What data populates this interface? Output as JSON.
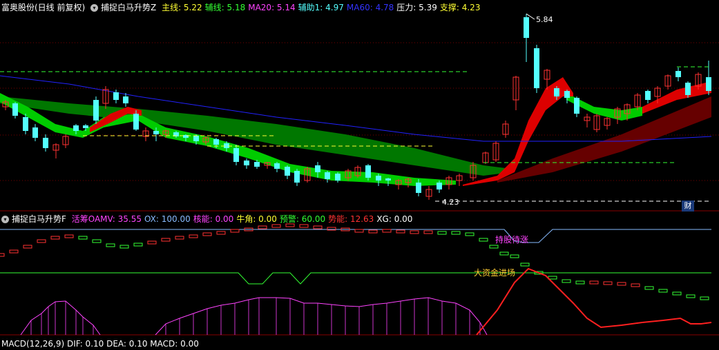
{
  "top_header": {
    "stock": "富奥股份(日线 前复权)",
    "indicator": "捕捉白马升势Z",
    "items": [
      {
        "label": "主线:",
        "value": "5.22",
        "color": "#ffff33"
      },
      {
        "label": "辅线:",
        "value": "5.18",
        "color": "#33ff33"
      },
      {
        "label": "MA20:",
        "value": "5.14",
        "color": "#ff44ff"
      },
      {
        "label": "辅助1:",
        "value": "4.97",
        "color": "#55ffff"
      },
      {
        "label": "MA60:",
        "value": "4.78",
        "color": "#3333ff"
      },
      {
        "label": "压力:",
        "value": "5.39",
        "color": "#ffffff"
      },
      {
        "label": "支撑:",
        "value": "4.23",
        "color": "#ffff33"
      }
    ]
  },
  "price_chart": {
    "high_label": "5.84",
    "low_label": "4.23",
    "finance_badge": "财",
    "colors": {
      "up": "#ff3232",
      "down": "#54ffff",
      "green_band": "#00cc00",
      "dark_green_band": "#007700",
      "red_band": "#dd0000",
      "dark_red_band": "#660000",
      "ma60": "#2222ff"
    }
  },
  "sub_header": {
    "indicator": "捕捉白马升势F",
    "items": [
      {
        "label": "活筹OAMV:",
        "value": "35.55",
        "color": "#ff44ff"
      },
      {
        "label": "OX:",
        "value": "100.00",
        "color": "#88bbff"
      },
      {
        "label": "核能:",
        "value": "0.00",
        "color": "#ff44ff"
      },
      {
        "label": "牛角:",
        "value": "0.00",
        "color": "#ffff33"
      },
      {
        "label": "预警:",
        "value": "60.00",
        "color": "#33ff33"
      },
      {
        "label": "势能:",
        "value": "12.63",
        "color": "#ff3232"
      },
      {
        "label": "XG:",
        "value": "0.00",
        "color": "#ffffff"
      }
    ]
  },
  "sub_chart": {
    "annotation_1": "持股待涨",
    "annotation_2": "大资金进场"
  },
  "bottom_header": {
    "text": "MACD(12,26,9)  DIF: 0.10  DEA: 0.10  MACD: 0.00"
  }
}
